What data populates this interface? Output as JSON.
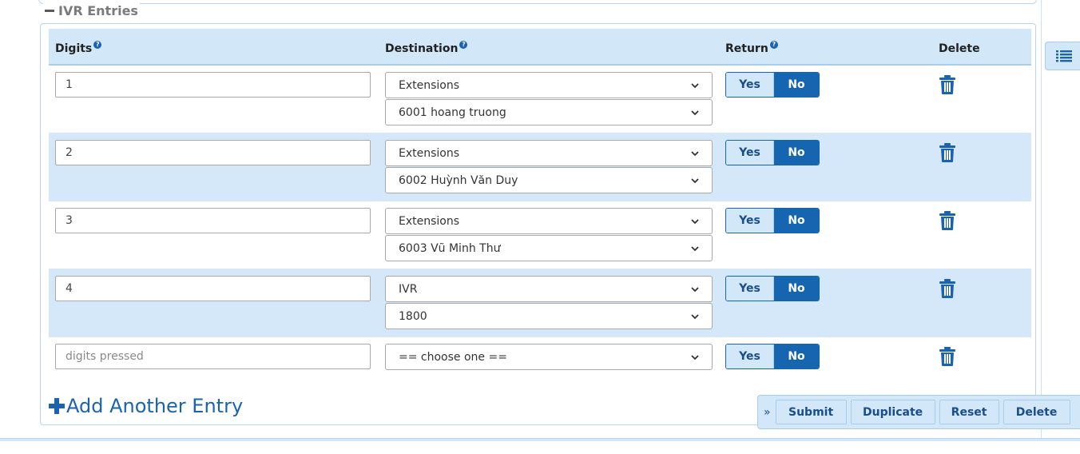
{
  "section": {
    "title": "IVR Entries"
  },
  "table": {
    "headers": {
      "digits": "Digits",
      "destination": "Destination",
      "return": "Return",
      "delete": "Delete"
    },
    "rows": [
      {
        "digits": "1",
        "dest_type": "Extensions",
        "dest_value": "6001 hoang truong",
        "return_yes": "Yes",
        "return_no": "No",
        "return_selected": "No"
      },
      {
        "digits": "2",
        "dest_type": "Extensions",
        "dest_value": "6002 Huỳnh Văn Duy",
        "return_yes": "Yes",
        "return_no": "No",
        "return_selected": "No"
      },
      {
        "digits": "3",
        "dest_type": "Extensions",
        "dest_value": "6003 Vũ Minh Thư",
        "return_yes": "Yes",
        "return_no": "No",
        "return_selected": "No"
      },
      {
        "digits": "4",
        "dest_type": "IVR",
        "dest_value": "1800",
        "return_yes": "Yes",
        "return_no": "No",
        "return_selected": "No"
      }
    ],
    "new_row": {
      "digits_placeholder": "digits pressed",
      "dest_type": "== choose one ==",
      "return_yes": "Yes",
      "return_no": "No",
      "return_selected": "No"
    }
  },
  "add_entry_label": "Add Another Entry",
  "actions": {
    "submit": "Submit",
    "duplicate": "Duplicate",
    "reset": "Reset",
    "delete": "Delete",
    "collapse_icon": "»"
  },
  "icons": {
    "help": "help-icon",
    "trash": "trash-icon",
    "plus": "plus-icon",
    "list": "list-icon"
  },
  "colors": {
    "accent": "#1565b0",
    "header_bg": "#d2e7f8",
    "link": "#1a63b0"
  }
}
